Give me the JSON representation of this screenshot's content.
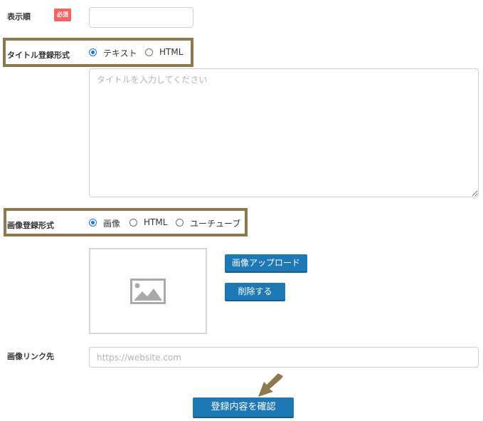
{
  "display_order": {
    "label": "表示順",
    "required_badge": "必須",
    "value": ""
  },
  "title_format": {
    "label": "タイトル登録形式",
    "options": [
      "テキスト",
      "HTML"
    ],
    "selected": "テキスト"
  },
  "title_input": {
    "placeholder": "タイトルを入力してください",
    "value": ""
  },
  "image_format": {
    "label": "画像登録形式",
    "options": [
      "画像",
      "HTML",
      "ユーチューブ"
    ],
    "selected": "画像"
  },
  "image_preview": {
    "icon": "image-placeholder-icon"
  },
  "buttons": {
    "upload": "画像アップロード",
    "delete": "削除する",
    "confirm": "登録内容を確認"
  },
  "image_link": {
    "label": "画像リンク先",
    "placeholder": "https://website.com",
    "value": ""
  },
  "colors": {
    "accent": "#1e78b4",
    "highlight_frame": "#8c7a4e",
    "badge": "#f06464",
    "radio_checked": "#1a73e8"
  }
}
